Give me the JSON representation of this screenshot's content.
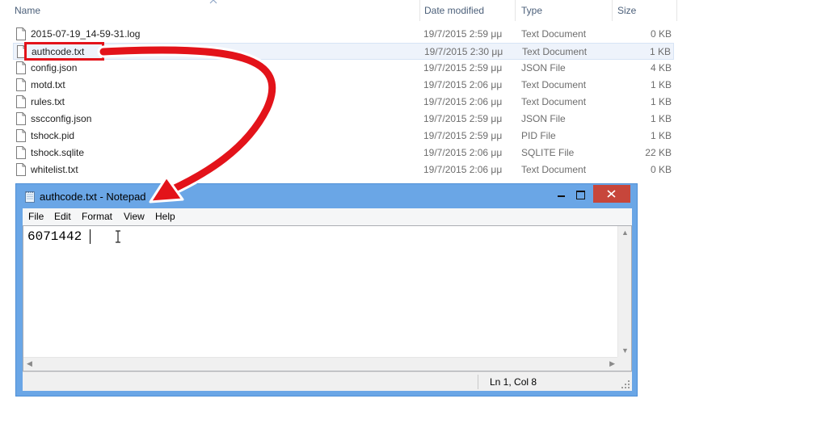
{
  "explorer": {
    "columns": {
      "name": "Name",
      "date": "Date modified",
      "type": "Type",
      "size": "Size"
    },
    "files": [
      {
        "name": "2015-07-19_14-59-31.log",
        "date": "19/7/2015 2:59 μμ",
        "type": "Text Document",
        "size": "0 KB"
      },
      {
        "name": "authcode.txt",
        "date": "19/7/2015 2:30 μμ",
        "type": "Text Document",
        "size": "1 KB"
      },
      {
        "name": "config.json",
        "date": "19/7/2015 2:59 μμ",
        "type": "JSON File",
        "size": "4 KB"
      },
      {
        "name": "motd.txt",
        "date": "19/7/2015 2:06 μμ",
        "type": "Text Document",
        "size": "1 KB"
      },
      {
        "name": "rules.txt",
        "date": "19/7/2015 2:06 μμ",
        "type": "Text Document",
        "size": "1 KB"
      },
      {
        "name": "sscconfig.json",
        "date": "19/7/2015 2:59 μμ",
        "type": "JSON File",
        "size": "1 KB"
      },
      {
        "name": "tshock.pid",
        "date": "19/7/2015 2:59 μμ",
        "type": "PID File",
        "size": "1 KB"
      },
      {
        "name": "tshock.sqlite",
        "date": "19/7/2015 2:06 μμ",
        "type": "SQLITE File",
        "size": "22 KB"
      },
      {
        "name": "whitelist.txt",
        "date": "19/7/2015 2:06 μμ",
        "type": "Text Document",
        "size": "0 KB"
      }
    ]
  },
  "notepad": {
    "title": "authcode.txt - Notepad",
    "menu": [
      "File",
      "Edit",
      "Format",
      "View",
      "Help"
    ],
    "content": "6071442",
    "status": "Ln 1, Col 8"
  },
  "annotation": {
    "color": "#e3131a"
  },
  "icons": [
    "file-icon",
    "notepad-icon",
    "minimize-icon",
    "maximize-icon",
    "close-icon",
    "ibeam-cursor-icon",
    "sort-arrow-icon"
  ]
}
